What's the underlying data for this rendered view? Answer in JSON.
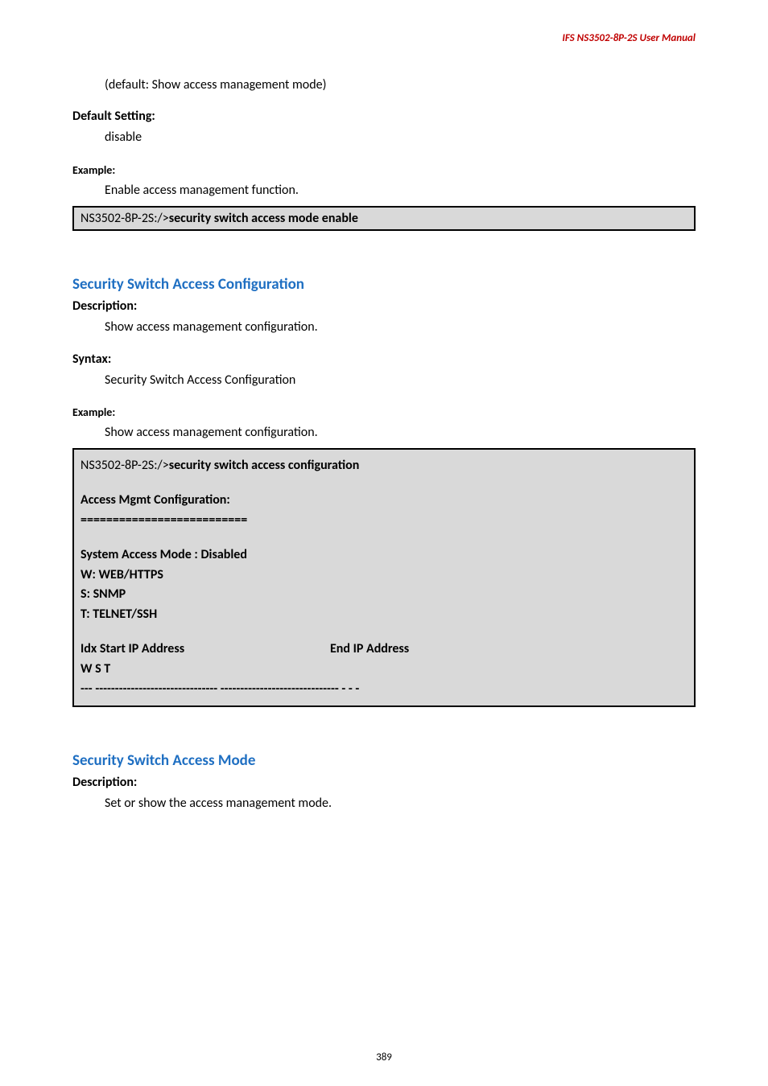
{
  "header": {
    "product_manual": "IFS  NS3502-8P-2S  User  Manual"
  },
  "intro": {
    "default_note": "(default: Show access management mode)",
    "default_setting_label": "Default Setting:",
    "default_setting_value": "disable",
    "example_label": "Example:",
    "example_text": "Enable access management function.",
    "cmd_prefix": "NS3502-8P-2S:/>",
    "cmd_text": "security switch access mode enable"
  },
  "section1": {
    "heading": "Security Switch Access Configuration",
    "description_label": "Description:",
    "description_text": "Show access management configuration.",
    "syntax_label": "Syntax:",
    "syntax_text": "Security Switch Access Configuration",
    "example_label": "Example:",
    "example_text": "Show access management configuration.",
    "box": {
      "cmd_prefix": "NS3502-8P-2S:/>",
      "cmd_text": "security switch access configuration",
      "conf_title": "Access Mgmt Configuration:",
      "conf_sep": "==========================",
      "mode_line": "System Access Mode : Disabled",
      "w_line": "W: WEB/HTTPS",
      "s_line": "S: SNMP",
      "t_line": "T: TELNET/SSH",
      "header_col1": "Idx Start IP Address",
      "header_col2": "End IP Address",
      "wst": "W S T",
      "dashline": "--- ------------------------------- ------------------------------ - - -"
    }
  },
  "section2": {
    "heading": "Security Switch Access Mode",
    "description_label": "Description:",
    "description_text": "Set or show the access management mode."
  },
  "footer": {
    "page_number": "389"
  }
}
